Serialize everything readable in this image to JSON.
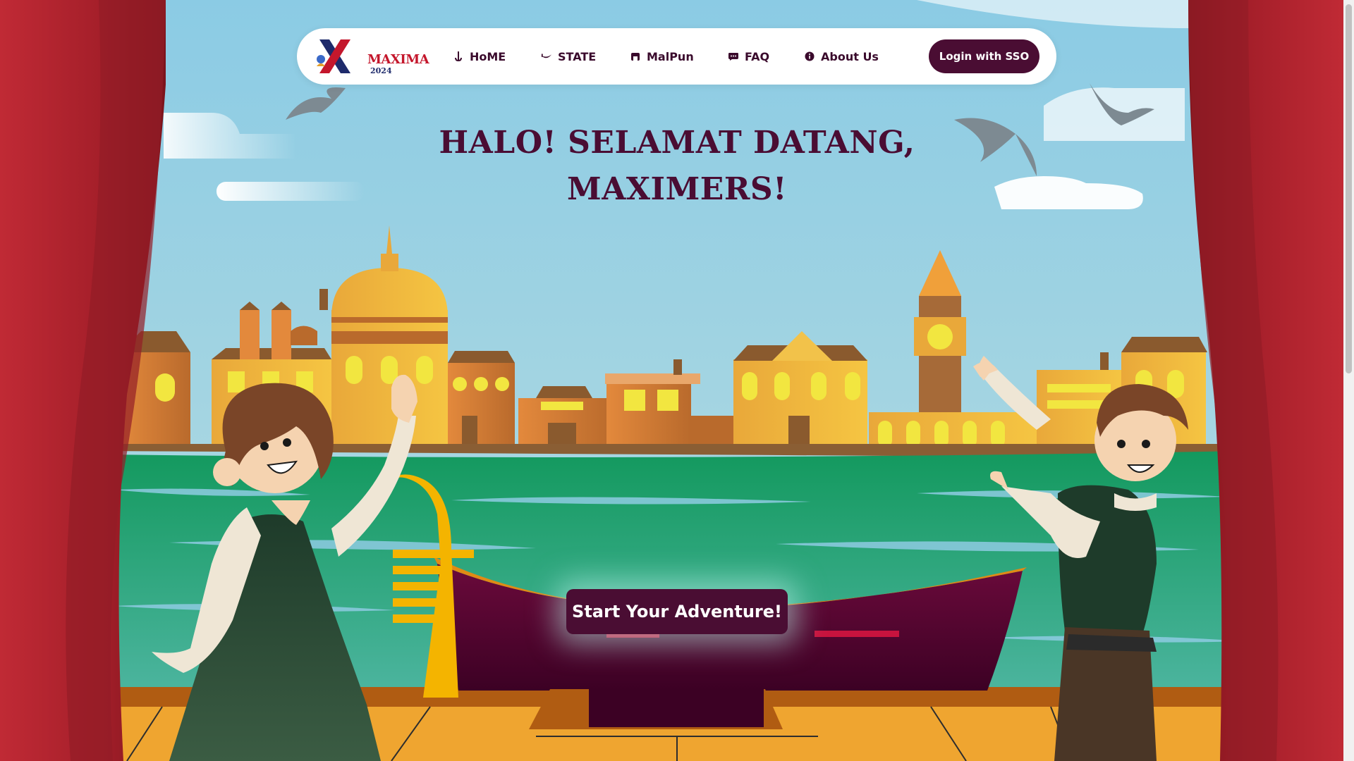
{
  "brand": {
    "logo_text": "MAXIMA",
    "logo_year": "2024"
  },
  "nav": {
    "items": [
      {
        "label": "HoME",
        "icon": "anchor-icon"
      },
      {
        "label": "STATE",
        "icon": "gondola-icon"
      },
      {
        "label": "MalPun",
        "icon": "calendar-icon"
      },
      {
        "label": "FAQ",
        "icon": "chat-icon"
      },
      {
        "label": "About Us",
        "icon": "info-icon"
      }
    ],
    "login_label": "Login with SSO"
  },
  "hero": {
    "title_line1": "HALO! SELAMAT DATANG,",
    "title_line2": "MAXIMERS!",
    "cta_label": "Start Your Adventure!"
  },
  "colors": {
    "primary": "#4a0d33",
    "curtain": "#b3232e",
    "sky": "#8ecbe2",
    "water": "#1f9e6b"
  }
}
